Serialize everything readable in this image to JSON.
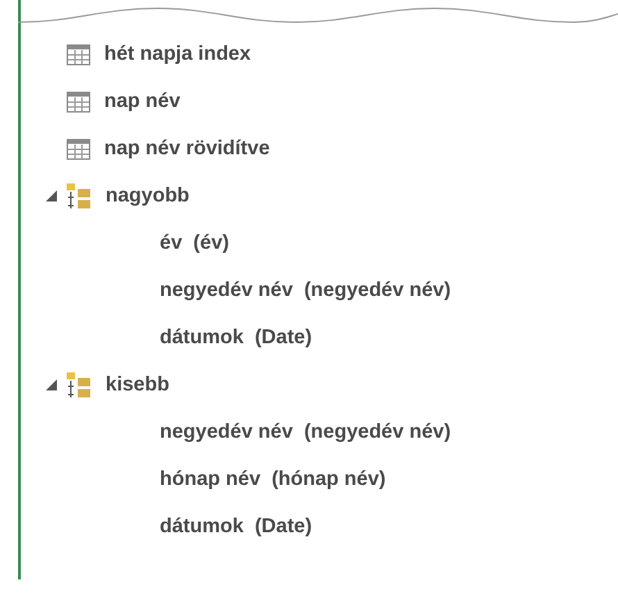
{
  "fields": [
    {
      "kind": "column",
      "label": "hét napja index"
    },
    {
      "kind": "column",
      "label": "nap név"
    },
    {
      "kind": "column",
      "label": "nap név rövidítve"
    },
    {
      "kind": "hierarchy",
      "label": "nagyobb",
      "expanded": true,
      "children": [
        {
          "label": "év  (év)"
        },
        {
          "label": "negyedév név  (negyedév név)"
        },
        {
          "label": "dátumok  (Date)"
        }
      ]
    },
    {
      "kind": "hierarchy",
      "label": "kisebb",
      "expanded": true,
      "children": [
        {
          "label": "negyedév név  (negyedév név)"
        },
        {
          "label": "hónap név  (hónap név)"
        },
        {
          "label": "dátumok  (Date)"
        }
      ]
    }
  ]
}
